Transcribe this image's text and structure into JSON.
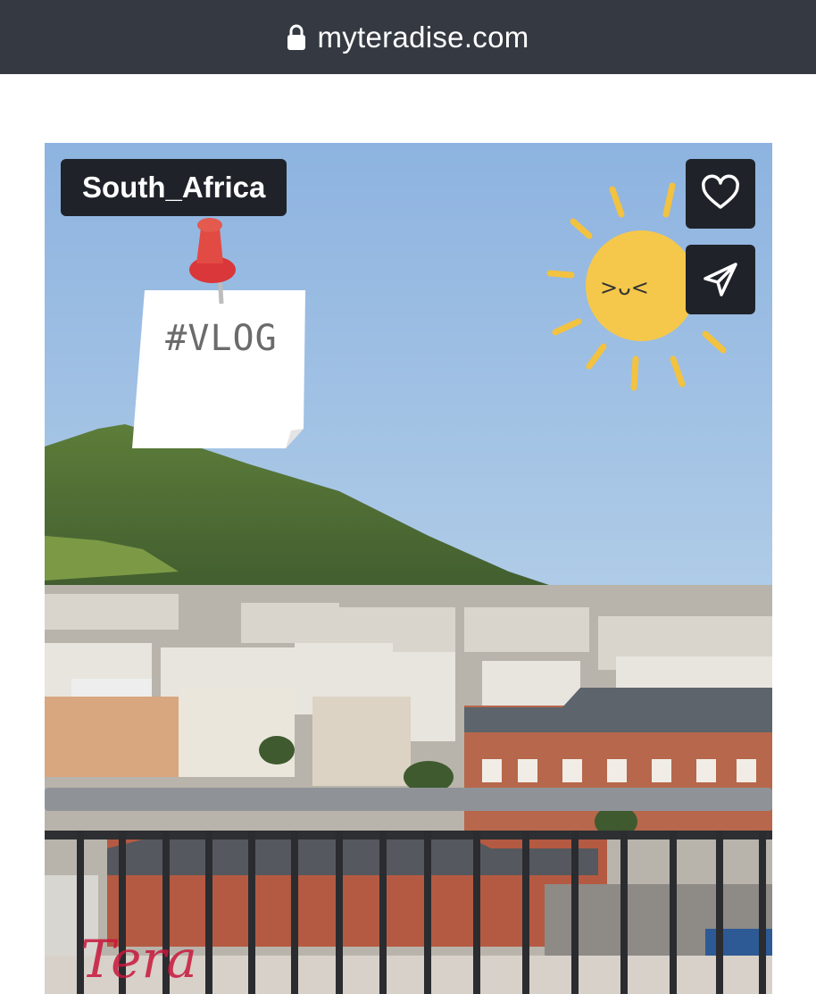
{
  "browser": {
    "url": "myteradise.com",
    "lock_icon": "lock-icon"
  },
  "post": {
    "location_tag": "South_Africa",
    "sticker_note": "#VLOG",
    "sun_face": ">ᴗ<",
    "watermark": "Tera",
    "actions": {
      "like_icon": "heart-icon",
      "share_icon": "send-icon"
    }
  },
  "colors": {
    "url_bar": "#353a42",
    "button_bg": "#1f2329",
    "sky": "#8fb5de",
    "sun": "#f5c84b",
    "pin": "#e0403a"
  }
}
